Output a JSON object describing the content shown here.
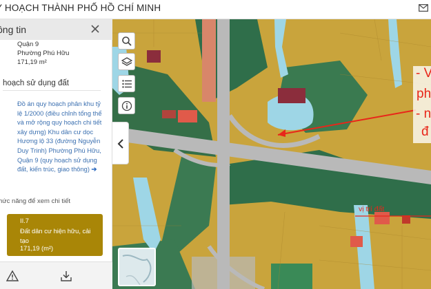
{
  "header": {
    "title": "QUY HOẠCH THÀNH PHỐ HỒ CHÍ MINH",
    "title_visible": "Y HOẠCH THÀNH PHỐ HỒ CHÍ MINH",
    "mail_icon": "mail-icon"
  },
  "panel": {
    "title": "ông tin",
    "close_icon": "close-icon",
    "district": "Quận 9",
    "ward": "Phường Phú Hữu",
    "area": "171,19 m²",
    "section_title": "hoạch sử dụng đất",
    "plan_link": "Đồ án quy hoạch phân khu tỷ lệ 1/2000 (điều chỉnh tổng thể và mở rộng quy hoạch chi tiết xây dựng) Khu dân cư dọc Hương lộ 33 (đường Nguyễn Duy Trinh) Phường Phú Hữu, Quận 9 (quy hoạch sử dụng đất, kiến trúc, giao thông)",
    "plan_link_arrow": "➔",
    "hint": "hức năng để xem chi tiết",
    "detail": {
      "code": "II.7",
      "description": "Đất dân cư hiện hữu, cải tạo",
      "area": "171,19 (m²)",
      "color": "#a98607"
    },
    "footer_icons": [
      "warning-icon",
      "download-icon"
    ],
    "collapse_icon": "chevron-left-icon"
  },
  "map_tools": [
    "search-icon",
    "layers-icon",
    "list-icon",
    "info-icon"
  ],
  "annotations": {
    "lines": [
      "- V",
      "ph",
      "- n",
      "đ"
    ],
    "location_label": "vị trí đất",
    "accent": "#e8261a"
  },
  "colors": {
    "residential": "#c9a43c",
    "green": "#2f6e4a",
    "water": "#9ed6e6",
    "road": "#b9b9b9",
    "public": "#e05a4a",
    "commercial": "#8b2d3c"
  }
}
